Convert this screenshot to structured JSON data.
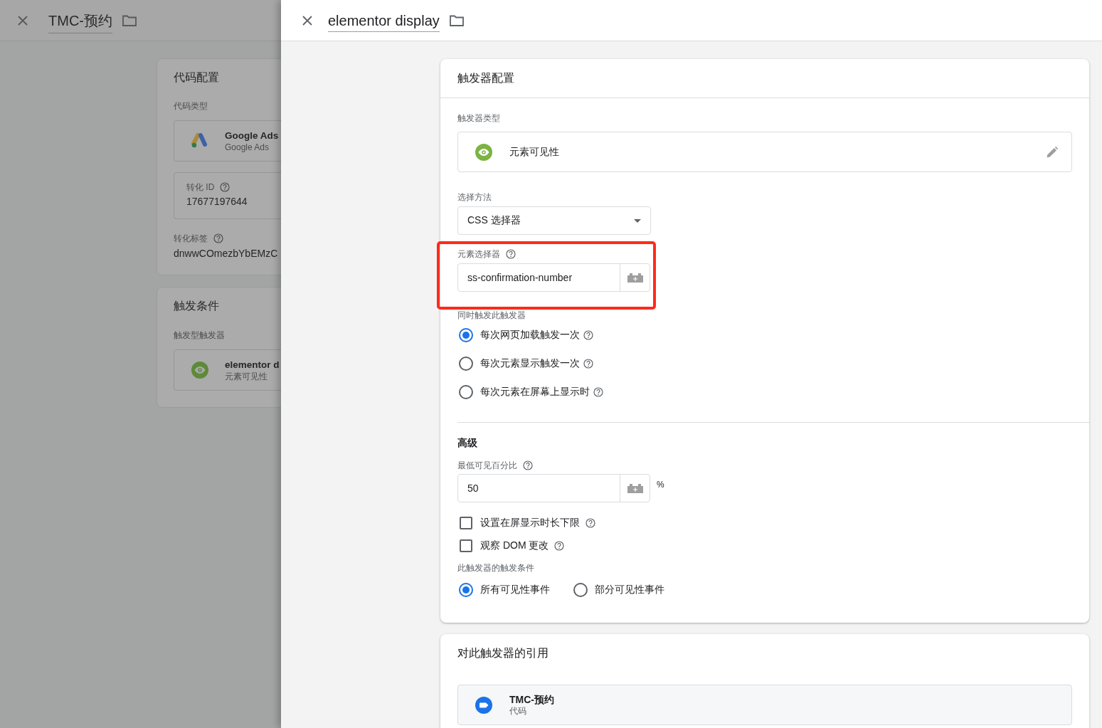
{
  "background_tag": {
    "title": "TMC-预约",
    "config_card": {
      "title": "代码配置",
      "type_label": "代码类型",
      "tag_type": {
        "name": "Google Ads",
        "subtitle": "Google Ads"
      },
      "conversion_id": {
        "label": "转化 ID",
        "value": "17677197644"
      },
      "conversion_label": {
        "label": "转化标签",
        "value": "dnwwCOmezbYbEMzC"
      }
    },
    "triggering_card": {
      "title": "触发条件",
      "label": "触发型触发器",
      "trigger": {
        "name": "elementor d",
        "subtitle": "元素可见性"
      }
    }
  },
  "trigger": {
    "title": "elementor display",
    "config_card": {
      "title": "触发器配置",
      "type_label": "触发器类型",
      "type_name": "元素可见性",
      "selection_method": {
        "label": "选择方法",
        "value": "CSS 选择器"
      },
      "element_selector": {
        "label": "元素选择器",
        "value": "ss-confirmation-number",
        "highlighted": true
      },
      "fire_label": "同时触发此触发器",
      "fire_options": [
        {
          "label": "每次网页加载触发一次",
          "selected": true
        },
        {
          "label": "每次元素显示触发一次",
          "selected": false
        },
        {
          "label": "每次元素在屏幕上显示时",
          "selected": false
        }
      ],
      "advanced": {
        "title": "高级",
        "min_percent": {
          "label": "最低可见百分比",
          "value": "50",
          "unit": "%"
        },
        "checkboxes": [
          {
            "label": "设置在屏显示时长下限",
            "checked": false
          },
          {
            "label": "观察 DOM 更改",
            "checked": false
          }
        ],
        "condition_label": "此触发器的触发条件",
        "conditions": [
          {
            "label": "所有可见性事件",
            "selected": true
          },
          {
            "label": "部分可见性事件",
            "selected": false
          }
        ]
      }
    },
    "references": {
      "title": "对此触发器的引用",
      "items": [
        {
          "name": "TMC-预约",
          "type": "代码"
        }
      ]
    }
  }
}
